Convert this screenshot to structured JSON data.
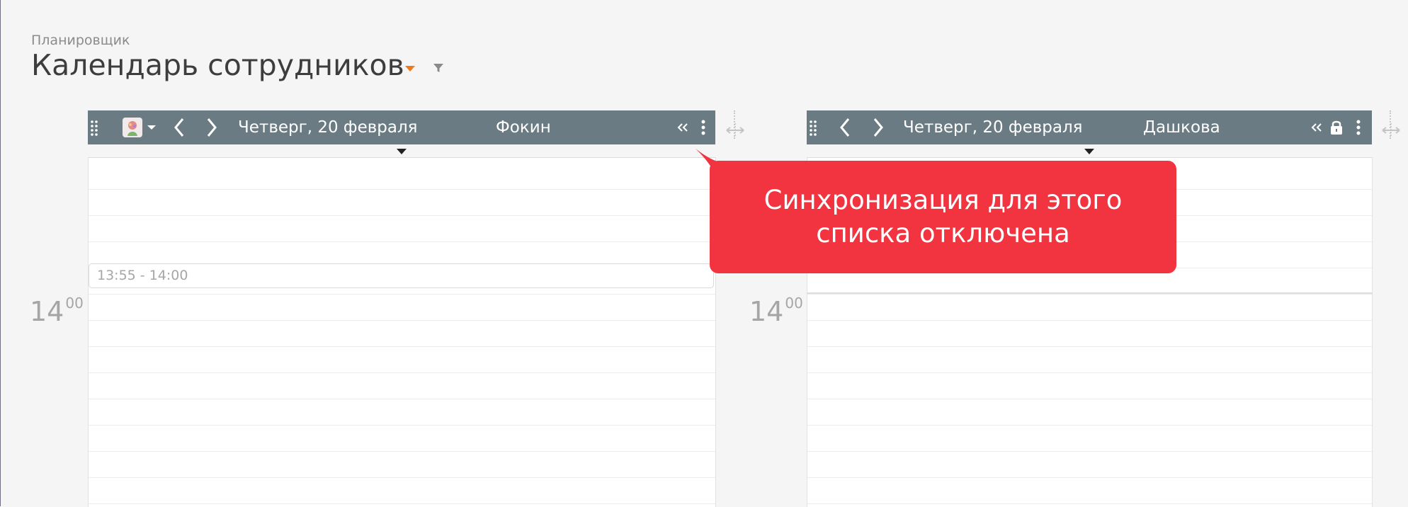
{
  "page": {
    "breadcrumb": "Планировщик",
    "title": "Календарь сотрудников"
  },
  "colors": {
    "header_bg": "#6b7b83",
    "accent": "#f07a1a",
    "tooltip_bg": "#f1343f"
  },
  "panels": [
    {
      "date": "Четверг, 20 февраля",
      "employee": "Фокин",
      "icons": [
        "drag-handle-icon",
        "avatar",
        "chevron-down-icon",
        "chevron-left-icon",
        "chevron-right-icon",
        "collapse-icon",
        "more-icon"
      ]
    },
    {
      "date": "Четверг, 20 февраля",
      "employee": "Дашкова",
      "icons": [
        "drag-handle-icon",
        "chevron-left-icon",
        "chevron-right-icon",
        "collapse-icon",
        "lock-icon",
        "more-icon"
      ]
    }
  ],
  "hours": {
    "hour": "14",
    "minutes": "00"
  },
  "event": {
    "time": "13:55 - 14:00"
  },
  "tooltip": {
    "text": "Синхронизация для этого списка отключена"
  }
}
